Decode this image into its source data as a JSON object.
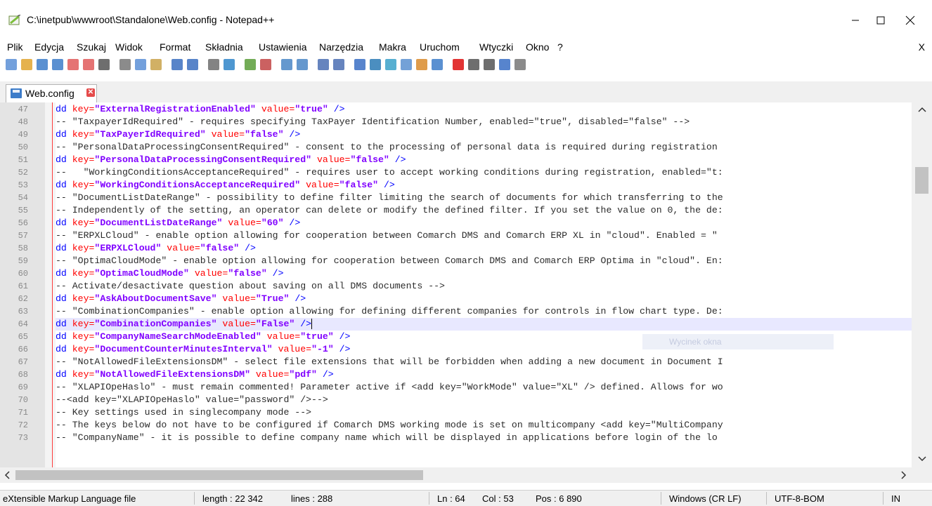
{
  "window": {
    "title": "C:\\inetpub\\wwwroot\\Standalone\\Web.config - Notepad++",
    "minimize": "—",
    "maximize": "☐",
    "close": "✕"
  },
  "menu": {
    "items": [
      "Plik",
      "Edycja",
      "Szukaj",
      "Widok",
      "Format",
      "Składnia",
      "Ustawienia",
      "Narzędzia",
      "Makra",
      "Uruchom",
      "Wtyczki",
      "Okno",
      "?"
    ],
    "close": "X"
  },
  "toolbar": {
    "icons": [
      "new-file-icon",
      "open-file-icon",
      "save-icon",
      "save-all-icon",
      "close-icon",
      "close-all-icon",
      "print-icon",
      "cut-icon",
      "copy-icon",
      "paste-icon",
      "undo-icon",
      "redo-icon",
      "find-icon",
      "replace-icon",
      "zoom-in-icon",
      "zoom-out-icon",
      "sync-vertical-icon",
      "sync-horizontal-icon",
      "word-wrap-icon",
      "show-all-chars-icon",
      "indent-guide-icon",
      "udl-icon",
      "doc-map-icon",
      "function-list-icon",
      "folder-as-workspace-icon",
      "monitoring-icon",
      "record-macro-icon",
      "stop-record-icon",
      "play-macro-icon",
      "run-macro-multiple-icon",
      "save-macro-icon"
    ]
  },
  "tab": {
    "label": "Web.config",
    "close": "✕"
  },
  "editor": {
    "lines": [
      {
        "n": "47",
        "parts": [
          [
            "tag",
            "dd "
          ],
          [
            "attr",
            "key="
          ],
          [
            "val",
            "\"ExternalRegistrationEnabled\""
          ],
          [
            "attr",
            " value="
          ],
          [
            "val",
            "\"true\""
          ],
          [
            "tag",
            " />"
          ]
        ]
      },
      {
        "n": "48",
        "parts": [
          [
            "cmt",
            "-- \"TaxpayerIdRequired\" - requires specifying TaxPayer Identification Number, enabled=\"true\", disabled=\"false\" -->"
          ]
        ]
      },
      {
        "n": "49",
        "parts": [
          [
            "tag",
            "dd "
          ],
          [
            "attr",
            "key="
          ],
          [
            "val",
            "\"TaxPayerIdRequired\""
          ],
          [
            "attr",
            " value="
          ],
          [
            "val",
            "\"false\""
          ],
          [
            "tag",
            " />"
          ]
        ]
      },
      {
        "n": "50",
        "parts": [
          [
            "cmt",
            "-- \"PersonalDataProcessingConsentRequired\" - consent to the processing of personal data is required during registration"
          ]
        ]
      },
      {
        "n": "51",
        "parts": [
          [
            "tag",
            "dd "
          ],
          [
            "attr",
            "key="
          ],
          [
            "val",
            "\"PersonalDataProcessingConsentRequired\""
          ],
          [
            "attr",
            " value="
          ],
          [
            "val",
            "\"false\""
          ],
          [
            "tag",
            " />"
          ]
        ]
      },
      {
        "n": "52",
        "parts": [
          [
            "cmt",
            "--   \"WorkingConditionsAcceptanceRequired\" - requires user to accept working conditions during registration, enabled=\"t:"
          ]
        ]
      },
      {
        "n": "53",
        "parts": [
          [
            "tag",
            "dd "
          ],
          [
            "attr",
            "key="
          ],
          [
            "val",
            "\"WorkingConditionsAcceptanceRequired\""
          ],
          [
            "attr",
            " value="
          ],
          [
            "val",
            "\"false\""
          ],
          [
            "tag",
            " />"
          ]
        ]
      },
      {
        "n": "54",
        "parts": [
          [
            "cmt",
            "-- \"DocumentListDateRange\" - possibility to define filter limiting the search of documents for which transferring to the"
          ]
        ]
      },
      {
        "n": "55",
        "parts": [
          [
            "cmt",
            "-- Independently of the setting, an operator can delete or modify the defined filter. If you set the value on 0, the de:"
          ]
        ]
      },
      {
        "n": "56",
        "parts": [
          [
            "tag",
            "dd "
          ],
          [
            "attr",
            "key="
          ],
          [
            "val",
            "\"DocumentListDateRange\""
          ],
          [
            "attr",
            " value="
          ],
          [
            "val",
            "\"60\""
          ],
          [
            "tag",
            " />"
          ]
        ]
      },
      {
        "n": "57",
        "parts": [
          [
            "cmt",
            "-- \"ERPXLCloud\" - enable option allowing for cooperation between Comarch DMS and Comarch ERP XL in \"cloud\". Enabled = \""
          ]
        ]
      },
      {
        "n": "58",
        "parts": [
          [
            "tag",
            "dd "
          ],
          [
            "attr",
            "key="
          ],
          [
            "val",
            "\"ERPXLCloud\""
          ],
          [
            "attr",
            " value="
          ],
          [
            "val",
            "\"false\""
          ],
          [
            "tag",
            " />"
          ]
        ]
      },
      {
        "n": "59",
        "parts": [
          [
            "cmt",
            "-- \"OptimaCloudMode\" - enable option allowing for cooperation between Comarch DMS and Comarch ERP Optima in \"cloud\". En:"
          ]
        ]
      },
      {
        "n": "60",
        "parts": [
          [
            "tag",
            "dd "
          ],
          [
            "attr",
            "key="
          ],
          [
            "val",
            "\"OptimaCloudMode\""
          ],
          [
            "attr",
            " value="
          ],
          [
            "val",
            "\"false\""
          ],
          [
            "tag",
            " />"
          ]
        ]
      },
      {
        "n": "61",
        "parts": [
          [
            "cmt",
            "-- Activate/desactivate question about saving on all DMS documents -->"
          ]
        ]
      },
      {
        "n": "62",
        "parts": [
          [
            "tag",
            "dd "
          ],
          [
            "attr",
            "key="
          ],
          [
            "val",
            "\"AskAboutDocumentSave\""
          ],
          [
            "attr",
            " value="
          ],
          [
            "val",
            "\"True\""
          ],
          [
            "tag",
            " />"
          ]
        ]
      },
      {
        "n": "63",
        "parts": [
          [
            "cmt",
            "-- \"CombinationCompanies\" - enable option allowing for defining different companies for controls in flow chart type. De:"
          ]
        ]
      },
      {
        "n": "64",
        "current": true,
        "parts": [
          [
            "tag",
            "dd "
          ],
          [
            "attr",
            "key="
          ],
          [
            "val",
            "\"CombinationCompanies\""
          ],
          [
            "attr",
            " value="
          ],
          [
            "val",
            "\"False\""
          ],
          [
            "tag",
            " />"
          ]
        ]
      },
      {
        "n": "65",
        "parts": [
          [
            "tag",
            "dd "
          ],
          [
            "attr",
            "key="
          ],
          [
            "val",
            "\"CompanyNameSearchModeEnabled\""
          ],
          [
            "attr",
            " value="
          ],
          [
            "val",
            "\"true\""
          ],
          [
            "tag",
            " />"
          ]
        ]
      },
      {
        "n": "66",
        "parts": [
          [
            "tag",
            "dd "
          ],
          [
            "attr",
            "key="
          ],
          [
            "val",
            "\"DocumentCounterMinutesInterval\""
          ],
          [
            "attr",
            " value="
          ],
          [
            "val",
            "\"-1\""
          ],
          [
            "tag",
            " />"
          ]
        ]
      },
      {
        "n": "67",
        "parts": [
          [
            "cmt",
            "-- \"NotAllowedFileExtensionsDM\" - select file extensions that will be forbidden when adding a new document in Document I"
          ]
        ]
      },
      {
        "n": "68",
        "parts": [
          [
            "tag",
            "dd "
          ],
          [
            "attr",
            "key="
          ],
          [
            "val",
            "\"NotAllowedFileExtensionsDM\""
          ],
          [
            "attr",
            " value="
          ],
          [
            "val",
            "\"pdf\""
          ],
          [
            "tag",
            " />"
          ]
        ]
      },
      {
        "n": "69",
        "parts": [
          [
            "cmt",
            "-- \"XLAPIOpeHaslo\" - must remain commented! Parameter active if <add key=\"WorkMode\" value=\"XL\" /> defined. Allows for wo"
          ]
        ]
      },
      {
        "n": "70",
        "parts": [
          [
            "cmt",
            "--<add key=\"XLAPIOpeHaslo\" value=\"password\" />-->"
          ]
        ]
      },
      {
        "n": "71",
        "parts": [
          [
            "cmt",
            "-- Key settings used in singlecompany mode -->"
          ]
        ]
      },
      {
        "n": "72",
        "parts": [
          [
            "cmt",
            "-- The keys below do not have to be configured if Comarch DMS working mode is set on multicompany <add key=\"MultiCompany"
          ]
        ]
      },
      {
        "n": "73",
        "parts": [
          [
            "cmt",
            "-- \"CompanyName\" - it is possible to define company name which will be displayed in applications before login of the lo"
          ]
        ]
      }
    ]
  },
  "overlay": {
    "text": "Wycinek okna"
  },
  "status": {
    "filetype": "eXtensible Markup Language file",
    "length": "length : 22 342",
    "lines": "lines : 288",
    "ln": "Ln : 64",
    "col": "Col : 53",
    "pos": "Pos : 6 890",
    "eol": "Windows (CR LF)",
    "encoding": "UTF-8-BOM",
    "mode": "IN"
  },
  "colors": {
    "tag": "#0000ff",
    "attr": "#ff0000",
    "val": "#8000ff",
    "current_line": "#e8e8ff"
  }
}
